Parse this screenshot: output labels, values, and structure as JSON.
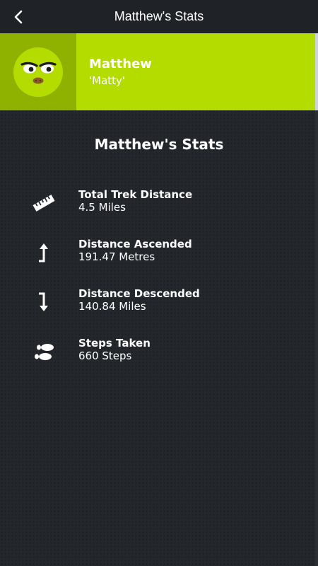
{
  "header": {
    "title": "Matthew's Stats"
  },
  "profile": {
    "name": "Matthew",
    "nickname": "'Matty'",
    "avatar_color": "#8fb200",
    "banner_color": "#b5dc00"
  },
  "stats_section": {
    "title": "Matthew's Stats",
    "items": [
      {
        "icon": "ruler-icon",
        "label": "Total Trek Distance",
        "value": "4.5 Miles"
      },
      {
        "icon": "arrow-up-icon",
        "label": "Distance Ascended",
        "value": "191.47 Metres"
      },
      {
        "icon": "arrow-down-icon",
        "label": "Distance Descended",
        "value": "140.84 Miles"
      },
      {
        "icon": "footprints-icon",
        "label": "Steps Taken",
        "value": "660 Steps"
      }
    ]
  },
  "colors": {
    "background": "#24282d",
    "topbar": "#1f2226",
    "accent": "#b5dc00"
  }
}
